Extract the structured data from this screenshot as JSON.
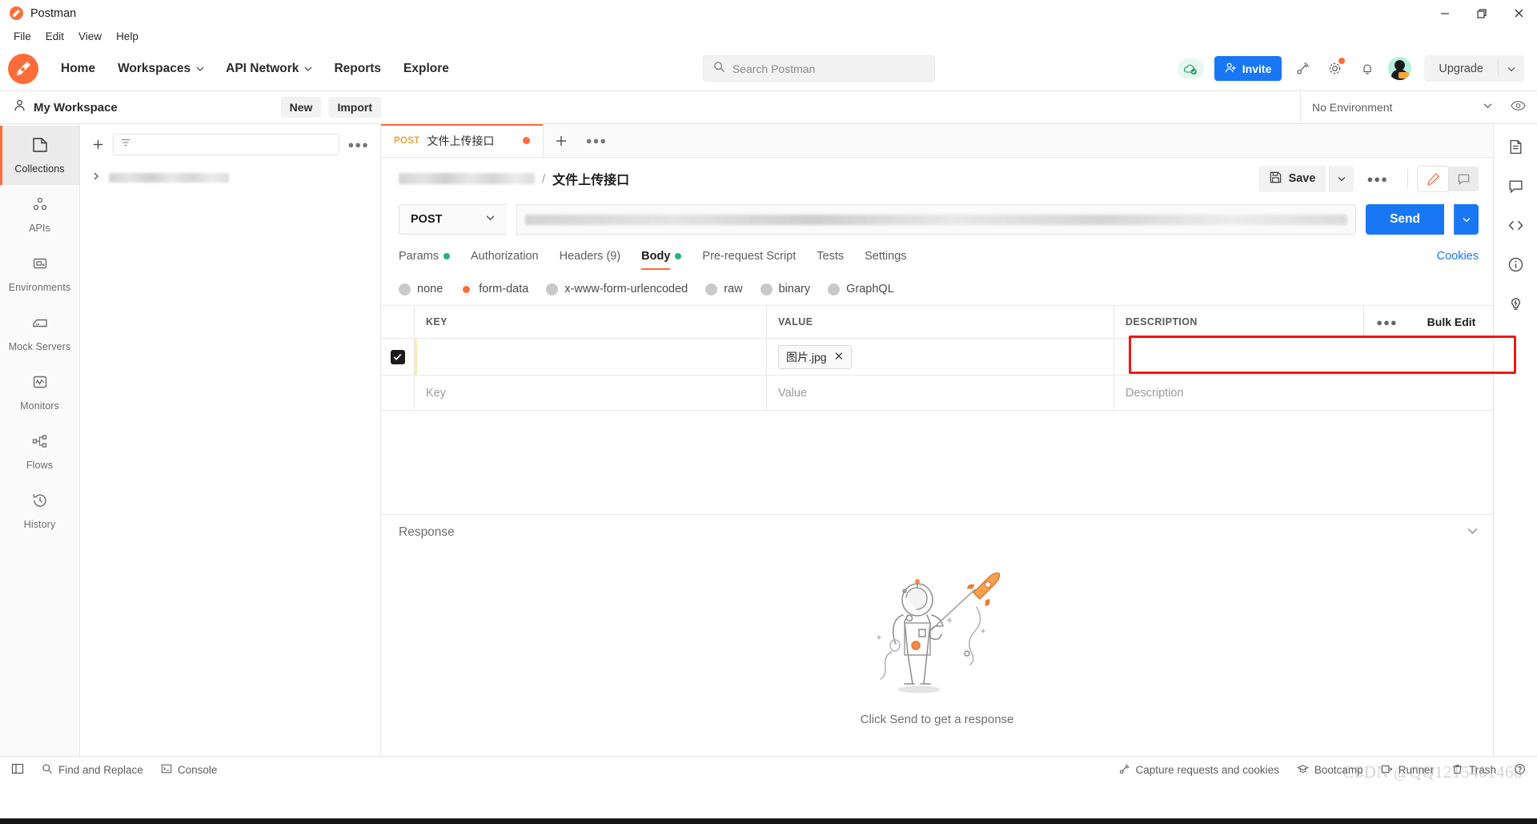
{
  "window": {
    "title": "Postman",
    "controls": {
      "minimize": "minimize-icon",
      "restore": "restore-icon",
      "close": "close-icon"
    }
  },
  "menubar": {
    "items": [
      "File",
      "Edit",
      "View",
      "Help"
    ]
  },
  "header": {
    "nav": [
      {
        "label": "Home",
        "caret": false
      },
      {
        "label": "Workspaces",
        "caret": true
      },
      {
        "label": "API Network",
        "caret": true
      },
      {
        "label": "Reports",
        "caret": false
      },
      {
        "label": "Explore",
        "caret": false
      }
    ],
    "search": {
      "placeholder": "Search Postman",
      "icon": "search-icon"
    },
    "invite_label": "Invite",
    "upgrade_label": "Upgrade",
    "icons": [
      "cloud-sync-icon",
      "satellite-icon",
      "gear-icon",
      "bell-icon",
      "avatar"
    ]
  },
  "workspace": {
    "name": "My Workspace",
    "new_label": "New",
    "import_label": "Import",
    "environment": "No Environment",
    "eye_icon": "eye-icon"
  },
  "sidebar": {
    "items": [
      {
        "label": "Collections",
        "icon": "collections-icon",
        "active": true
      },
      {
        "label": "APIs",
        "icon": "apis-icon",
        "active": false
      },
      {
        "label": "Environments",
        "icon": "environments-icon",
        "active": false
      },
      {
        "label": "Mock Servers",
        "icon": "mock-servers-icon",
        "active": false
      },
      {
        "label": "Monitors",
        "icon": "monitors-icon",
        "active": false
      },
      {
        "label": "Flows",
        "icon": "flows-icon",
        "active": false
      },
      {
        "label": "History",
        "icon": "history-icon",
        "active": false
      }
    ]
  },
  "collections_panel": {
    "filter_placeholder": "",
    "more_icon": "more-options-icon",
    "add_icon": "plus-icon",
    "items": [
      {
        "label": "",
        "redacted": true
      }
    ]
  },
  "request_tabs": [
    {
      "method": "POST",
      "name": "文件上传接口",
      "unsaved": true,
      "active": true
    }
  ],
  "breadcrumb": {
    "collection": "",
    "separator": "/",
    "current": "文件上传接口"
  },
  "actions": {
    "save_label": "Save",
    "save_icon": "save-icon",
    "more_icon": "more-options-icon",
    "edit_icon": "pencil-icon",
    "comment_icon": "comment-icon"
  },
  "url_bar": {
    "method": "POST",
    "url": "",
    "url_redacted": true,
    "send_label": "Send"
  },
  "request_tabs_row": {
    "tabs": [
      {
        "label": "Params",
        "dot": true,
        "active": false
      },
      {
        "label": "Authorization",
        "dot": false,
        "active": false
      },
      {
        "label": "Headers (9)",
        "dot": false,
        "active": false
      },
      {
        "label": "Body",
        "dot": true,
        "active": true
      },
      {
        "label": "Pre-request Script",
        "dot": false,
        "active": false
      },
      {
        "label": "Tests",
        "dot": false,
        "active": false
      },
      {
        "label": "Settings",
        "dot": false,
        "active": false
      }
    ],
    "cookies_label": "Cookies"
  },
  "body_types": [
    {
      "label": "none",
      "selected": false
    },
    {
      "label": "form-data",
      "selected": true
    },
    {
      "label": "x-www-form-urlencoded",
      "selected": false
    },
    {
      "label": "raw",
      "selected": false
    },
    {
      "label": "binary",
      "selected": false
    },
    {
      "label": "GraphQL",
      "selected": false
    }
  ],
  "form_data_table": {
    "columns": {
      "key": "KEY",
      "value": "VALUE",
      "description": "DESCRIPTION"
    },
    "bulk_edit_label": "Bulk Edit",
    "more_icon": "more-options-icon",
    "rows": [
      {
        "checked": true,
        "key": "",
        "value_file": "图片.jpg",
        "remove_icon": "close-icon",
        "description": "",
        "highlighted": true
      }
    ],
    "placeholder_row": {
      "key_placeholder": "Key",
      "value_placeholder": "Value",
      "description_placeholder": "Description"
    }
  },
  "response": {
    "title": "Response",
    "empty_message": "Click Send to get a response",
    "illustration": "astronaut-rocket-illustration"
  },
  "right_rail": {
    "icons": [
      "documentation-icon",
      "comments-icon",
      "code-icon",
      "info-icon",
      "lightbulb-icon"
    ]
  },
  "status_bar": {
    "left": [
      {
        "label": "",
        "icon": "sidebar-toggle-icon"
      },
      {
        "label": "Find and Replace",
        "icon": "search-icon"
      },
      {
        "label": "Console",
        "icon": "console-icon"
      }
    ],
    "right": [
      {
        "label": "Capture requests and cookies",
        "icon": "satellite-icon"
      },
      {
        "label": "Bootcamp",
        "icon": "graduation-cap-icon"
      },
      {
        "label": "Runner",
        "icon": "runner-icon"
      },
      {
        "label": "Trash",
        "icon": "trash-icon"
      },
      {
        "label": "",
        "icon": "help-icon"
      }
    ]
  },
  "watermark": {
    "text": "CSDN @QQ1215461468"
  },
  "colors": {
    "accent": "#ff6c37",
    "primary": "#1977f3",
    "green": "#23b47e",
    "highlight": "#f01717"
  }
}
